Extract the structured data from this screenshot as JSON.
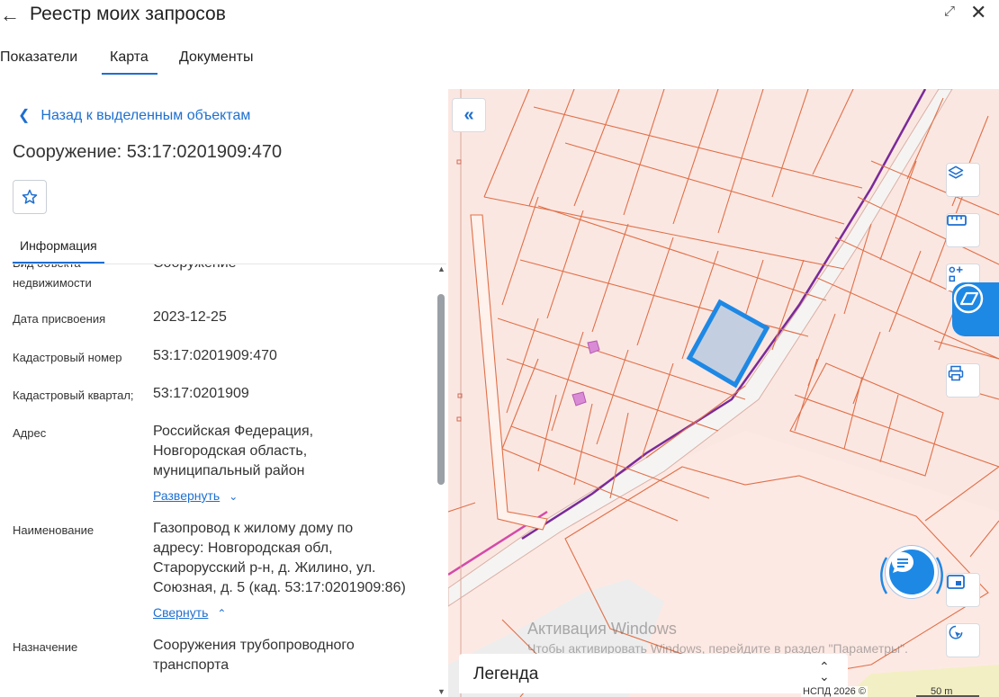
{
  "header": {
    "title": "Реестр моих запросов",
    "back_icon": "arrow-left-icon",
    "expand_icon": "expand-icon",
    "close_icon": "close-icon"
  },
  "tabs": [
    {
      "label": "Показатели",
      "active": false
    },
    {
      "label": "Карта",
      "active": true
    },
    {
      "label": "Документы",
      "active": false
    }
  ],
  "accent_color": "#1e6fd0",
  "panel": {
    "back_link": "Назад к выделенным объектам",
    "object_title": "Сооружение: 53:17:0201909:470",
    "info_tab": "Информация",
    "attributes": [
      {
        "label": "Вид объекта недвижимости",
        "value": "Сооружение"
      },
      {
        "label": "Дата присвоения",
        "value": "2023-12-25"
      },
      {
        "label": "Кадастровый номер",
        "value": "53:17:0201909:470"
      },
      {
        "label": "Кадастровый квартал;",
        "value": "53:17:0201909"
      },
      {
        "label": "Адрес",
        "value_lines": [
          "Российская Федерация,",
          "Новгородская область,",
          "муниципальный район"
        ],
        "link": "Развернуть"
      },
      {
        "label": "Наименование",
        "value_lines": [
          "Газопровод к жилому дому по",
          "адресу: Новгородская обл,",
          "Старорусский р-н, д. Жилино, ул.",
          "Союзная, д. 5 (кад. 53:17:0201909:86)"
        ],
        "link": "Свернуть"
      },
      {
        "label": "Назначение",
        "value_lines": [
          "Сооружения трубопроводного",
          "транспорта"
        ]
      }
    ]
  },
  "map": {
    "legend_label": "Легенда",
    "watermark_title": "Активация Windows",
    "watermark_subtitle": "Чтобы активировать Windows, перейдите в раздел \"Параметры\".",
    "attribution": "НСПД 2026 ©",
    "scale_label": "50 m",
    "parcel_color": "#e07048",
    "selection_color": "#1e88e5",
    "pipeline_color": "#7a2a9a",
    "controls": [
      "collapse-panel-icon",
      "layers-icon",
      "ruler-icon",
      "select-area-icon",
      "print-icon",
      "picture-in-picture-icon",
      "locate-icon",
      "chat-icon"
    ]
  }
}
